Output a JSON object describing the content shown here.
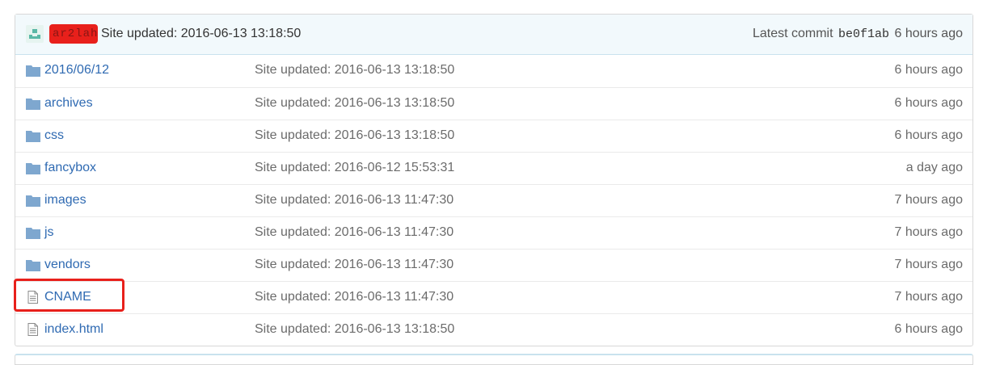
{
  "commit": {
    "author_visible": "Y",
    "author_redacted": "ar2lah",
    "message": "Site updated: 2016-06-13 13:18:50",
    "latest_label": "Latest commit",
    "sha": "be0f1ab",
    "age": "6 hours ago"
  },
  "files": [
    {
      "type": "folder",
      "name_prefix": "2016/06/",
      "name_link": "12",
      "message": "Site updated: 2016-06-13 13:18:50",
      "age": "6 hours ago"
    },
    {
      "type": "folder",
      "name": "archives",
      "message": "Site updated: 2016-06-13 13:18:50",
      "age": "6 hours ago"
    },
    {
      "type": "folder",
      "name": "css",
      "message": "Site updated: 2016-06-13 13:18:50",
      "age": "6 hours ago"
    },
    {
      "type": "folder",
      "name": "fancybox",
      "message": "Site updated: 2016-06-12 15:53:31",
      "age": "a day ago"
    },
    {
      "type": "folder",
      "name": "images",
      "message": "Site updated: 2016-06-13 11:47:30",
      "age": "7 hours ago"
    },
    {
      "type": "folder",
      "name": "js",
      "message": "Site updated: 2016-06-13 11:47:30",
      "age": "7 hours ago"
    },
    {
      "type": "folder",
      "name": "vendors",
      "message": "Site updated: 2016-06-13 11:47:30",
      "age": "7 hours ago"
    },
    {
      "type": "file",
      "name": "CNAME",
      "message": "Site updated: 2016-06-13 11:47:30",
      "age": "7 hours ago"
    },
    {
      "type": "file",
      "name": "index.html",
      "message": "Site updated: 2016-06-13 13:18:50",
      "age": "6 hours ago"
    }
  ],
  "colors": {
    "link": "#2f6ab2",
    "folder_icon": "#7ea7cf",
    "highlight": "#e8201b",
    "commit_bg": "#f2f9fc"
  },
  "icons": {
    "folder": "folder-icon",
    "file": "file-text-icon",
    "avatar": "identicon-avatar"
  }
}
